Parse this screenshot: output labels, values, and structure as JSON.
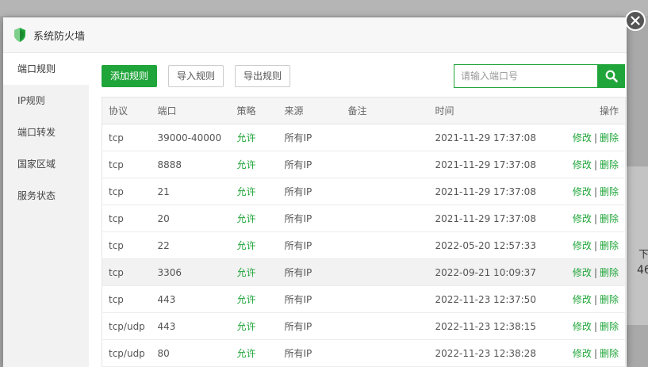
{
  "background": {
    "fragment_1": "下",
    "fragment_2": "46"
  },
  "dialog": {
    "title": "系统防火墙",
    "close_icon": "close-icon"
  },
  "sidebar": {
    "items": [
      {
        "label": "端口规则",
        "active": true
      },
      {
        "label": "IP规则",
        "active": false
      },
      {
        "label": "端口转发",
        "active": false
      },
      {
        "label": "国家区域",
        "active": false
      },
      {
        "label": "服务状态",
        "active": false
      }
    ]
  },
  "toolbar": {
    "add_label": "添加规则",
    "import_label": "导入规则",
    "export_label": "导出规则",
    "search_placeholder": "请输入端口号",
    "search_value": ""
  },
  "table": {
    "headers": {
      "protocol": "协议",
      "port": "端口",
      "policy": "策略",
      "source": "来源",
      "note": "备注",
      "time": "时间",
      "ops": "操作"
    },
    "edit_label": "修改",
    "delete_label": "删除",
    "separator": "|",
    "rows": [
      {
        "protocol": "tcp",
        "port": "39000-40000",
        "policy": "允许",
        "source": "所有IP",
        "note": "",
        "time": "2021-11-29 17:37:08"
      },
      {
        "protocol": "tcp",
        "port": "8888",
        "policy": "允许",
        "source": "所有IP",
        "note": "",
        "time": "2021-11-29 17:37:08"
      },
      {
        "protocol": "tcp",
        "port": "21",
        "policy": "允许",
        "source": "所有IP",
        "note": "",
        "time": "2021-11-29 17:37:08"
      },
      {
        "protocol": "tcp",
        "port": "20",
        "policy": "允许",
        "source": "所有IP",
        "note": "",
        "time": "2021-11-29 17:37:08"
      },
      {
        "protocol": "tcp",
        "port": "22",
        "policy": "允许",
        "source": "所有IP",
        "note": "",
        "time": "2022-05-20 12:57:33"
      },
      {
        "protocol": "tcp",
        "port": "3306",
        "policy": "允许",
        "source": "所有IP",
        "note": "",
        "time": "2022-09-21 10:09:37"
      },
      {
        "protocol": "tcp",
        "port": "443",
        "policy": "允许",
        "source": "所有IP",
        "note": "",
        "time": "2022-11-23 12:37:50"
      },
      {
        "protocol": "tcp/udp",
        "port": "443",
        "policy": "允许",
        "source": "所有IP",
        "note": "",
        "time": "2022-11-23 12:38:15"
      },
      {
        "protocol": "tcp/udp",
        "port": "80",
        "policy": "允许",
        "source": "所有IP",
        "note": "",
        "time": "2022-11-23 12:38:28"
      }
    ],
    "highlighted_row": 5
  },
  "colors": {
    "accent": "#20a53a",
    "overlay": "#a9a9a9"
  }
}
